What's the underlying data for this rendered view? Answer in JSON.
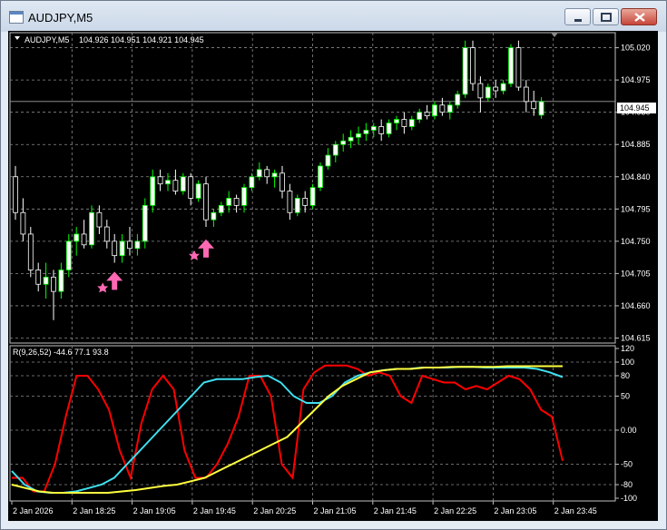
{
  "window": {
    "title": "AUDJPY,M5"
  },
  "header": {
    "symbol": "AUDJPY,M5",
    "ohlc": "104.926 104.951 104.921 104.945",
    "indicator": "R(9,26,52) -44.6 77.1 93.8"
  },
  "price_axis": {
    "ticks": [
      "105.020",
      "104.975",
      "104.930",
      "104.885",
      "104.840",
      "104.795",
      "104.750",
      "104.705",
      "104.660",
      "104.615"
    ],
    "tick_values": [
      105.02,
      104.975,
      104.93,
      104.885,
      104.84,
      104.795,
      104.75,
      104.705,
      104.66,
      104.615
    ],
    "current_price": "104.945"
  },
  "indicator_axis": {
    "ticks": [
      "120",
      "100",
      "80",
      "50",
      "0.00",
      "-50",
      "-80",
      "-100"
    ],
    "tick_values": [
      120,
      100,
      80,
      50,
      0,
      -50,
      -80,
      -100
    ]
  },
  "time_axis": {
    "labels": [
      "2 Jan 2026",
      "2 Jan 18:25",
      "2 Jan 19:05",
      "2 Jan 19:45",
      "2 Jan 20:25",
      "2 Jan 21:05",
      "2 Jan 21:45",
      "2 Jan 22:25",
      "2 Jan 23:05",
      "2 Jan 23:45"
    ]
  },
  "colors": {
    "background": "#000000",
    "grid": "#8c8c8c",
    "bull_candle": "#ffffff",
    "bear_candle": "#000000",
    "wick_up": "#00ff00",
    "wick_down": "#ffffff",
    "signal_arrow": "#ff69b4",
    "line_red": "#ff0000",
    "line_cyan": "#40e0f0",
    "line_yellow": "#ffff40"
  },
  "chart_data": {
    "type": "candlestick",
    "price_ylim": [
      104.608,
      105.041
    ],
    "candles": [
      [
        104.84,
        104.855,
        104.78,
        104.79
      ],
      [
        104.79,
        104.81,
        104.75,
        104.76
      ],
      [
        104.76,
        104.77,
        104.7,
        104.71
      ],
      [
        104.71,
        104.72,
        104.68,
        104.69
      ],
      [
        104.69,
        104.72,
        104.67,
        104.7
      ],
      [
        104.7,
        104.71,
        104.64,
        104.68
      ],
      [
        104.68,
        104.72,
        104.67,
        104.71
      ],
      [
        104.71,
        104.76,
        104.7,
        104.75
      ],
      [
        104.75,
        104.77,
        104.73,
        104.76
      ],
      [
        104.76,
        104.78,
        104.74,
        104.745
      ],
      [
        104.745,
        104.8,
        104.74,
        104.79
      ],
      [
        104.79,
        104.8,
        104.76,
        104.77
      ],
      [
        104.77,
        104.78,
        104.74,
        104.75
      ],
      [
        104.75,
        104.76,
        104.72,
        104.73
      ],
      [
        104.73,
        104.76,
        104.72,
        104.75
      ],
      [
        104.75,
        104.77,
        104.73,
        104.74
      ],
      [
        104.74,
        104.76,
        104.73,
        104.75
      ],
      [
        104.75,
        104.81,
        104.74,
        104.8
      ],
      [
        104.8,
        104.85,
        104.79,
        104.84
      ],
      [
        104.84,
        104.85,
        104.82,
        104.83
      ],
      [
        104.83,
        104.845,
        104.82,
        104.835
      ],
      [
        104.835,
        104.85,
        104.815,
        104.82
      ],
      [
        104.82,
        104.845,
        104.815,
        104.84
      ],
      [
        104.84,
        104.845,
        104.8,
        104.81
      ],
      [
        104.81,
        104.835,
        104.805,
        104.83
      ],
      [
        104.83,
        104.84,
        104.77,
        104.78
      ],
      [
        104.78,
        104.795,
        104.77,
        104.79
      ],
      [
        104.79,
        104.805,
        104.785,
        104.8
      ],
      [
        104.8,
        104.82,
        104.79,
        104.81
      ],
      [
        104.81,
        104.815,
        104.79,
        104.8
      ],
      [
        104.8,
        104.83,
        104.79,
        104.825
      ],
      [
        104.825,
        104.845,
        104.82,
        104.84
      ],
      [
        104.84,
        104.86,
        104.835,
        104.85
      ],
      [
        104.85,
        104.855,
        104.83,
        104.84
      ],
      [
        104.84,
        104.85,
        104.825,
        104.845
      ],
      [
        104.845,
        104.855,
        104.81,
        104.82
      ],
      [
        104.82,
        104.83,
        104.78,
        104.79
      ],
      [
        104.79,
        104.815,
        104.785,
        104.81
      ],
      [
        104.81,
        104.82,
        104.79,
        104.8
      ],
      [
        104.8,
        104.83,
        104.795,
        104.825
      ],
      [
        104.825,
        104.86,
        104.82,
        104.855
      ],
      [
        104.855,
        104.88,
        104.85,
        104.87
      ],
      [
        104.87,
        104.89,
        104.86,
        104.885
      ],
      [
        104.885,
        104.9,
        104.875,
        104.89
      ],
      [
        104.89,
        104.905,
        104.88,
        104.895
      ],
      [
        104.895,
        104.91,
        104.885,
        104.9
      ],
      [
        104.9,
        104.915,
        104.89,
        104.905
      ],
      [
        104.905,
        104.915,
        104.895,
        104.91
      ],
      [
        104.91,
        104.92,
        104.89,
        104.9
      ],
      [
        104.9,
        104.92,
        104.895,
        104.915
      ],
      [
        104.915,
        104.925,
        104.905,
        104.92
      ],
      [
        104.92,
        104.93,
        104.9,
        104.91
      ],
      [
        104.91,
        104.925,
        104.905,
        104.92
      ],
      [
        104.92,
        104.935,
        104.915,
        104.93
      ],
      [
        104.93,
        104.94,
        104.92,
        104.925
      ],
      [
        104.925,
        104.945,
        104.92,
        104.94
      ],
      [
        104.94,
        104.95,
        104.925,
        104.93
      ],
      [
        104.93,
        104.945,
        104.92,
        104.94
      ],
      [
        104.94,
        104.96,
        104.935,
        104.955
      ],
      [
        104.955,
        105.03,
        104.95,
        105.02
      ],
      [
        105.02,
        105.03,
        104.96,
        104.97
      ],
      [
        104.97,
        104.98,
        104.93,
        104.95
      ],
      [
        104.95,
        104.97,
        104.945,
        104.965
      ],
      [
        104.965,
        104.975,
        104.95,
        104.96
      ],
      [
        104.96,
        104.975,
        104.955,
        104.97
      ],
      [
        104.97,
        105.025,
        104.965,
        105.02
      ],
      [
        105.02,
        105.03,
        104.96,
        104.965
      ],
      [
        104.965,
        104.975,
        104.93,
        104.945
      ],
      [
        104.945,
        104.96,
        104.925,
        104.935
      ],
      [
        104.926,
        104.951,
        104.921,
        104.945
      ]
    ],
    "arrows": [
      {
        "index": 13,
        "price": 104.7
      },
      {
        "index": 25,
        "price": 104.745
      }
    ],
    "indicator_ylim": [
      -104,
      124
    ],
    "indicator_series": [
      {
        "color": "#ff0000",
        "values": [
          -70,
          -70,
          -90,
          -90,
          -50,
          20,
          80,
          80,
          60,
          30,
          -30,
          -70,
          10,
          60,
          80,
          60,
          -30,
          -70,
          -70,
          -50,
          -20,
          20,
          80,
          80,
          50,
          -50,
          -70,
          60,
          85,
          95,
          95,
          95,
          90,
          80,
          85,
          80,
          50,
          40,
          80,
          75,
          70,
          70,
          60,
          65,
          60,
          70,
          80,
          75,
          60,
          30,
          20,
          -45
        ]
      },
      {
        "color": "#40e0f0",
        "values": [
          -60,
          -80,
          -90,
          -92,
          -92,
          -90,
          -85,
          -80,
          -70,
          -50,
          -30,
          -10,
          10,
          30,
          50,
          70,
          75,
          75,
          75,
          78,
          80,
          70,
          50,
          40,
          40,
          50,
          70,
          80,
          85,
          88,
          90,
          90,
          92,
          92,
          92,
          93,
          93,
          92,
          92,
          92,
          92,
          90,
          85,
          78
        ]
      },
      {
        "color": "#ffff40",
        "values": [
          -80,
          -85,
          -90,
          -92,
          -92,
          -92,
          -92,
          -92,
          -90,
          -88,
          -85,
          -82,
          -80,
          -75,
          -70,
          -60,
          -50,
          -40,
          -30,
          -20,
          -10,
          10,
          30,
          50,
          65,
          75,
          85,
          88,
          90,
          90,
          92,
          92,
          93,
          93,
          93,
          93,
          94,
          94,
          94,
          94,
          94
        ]
      }
    ]
  }
}
